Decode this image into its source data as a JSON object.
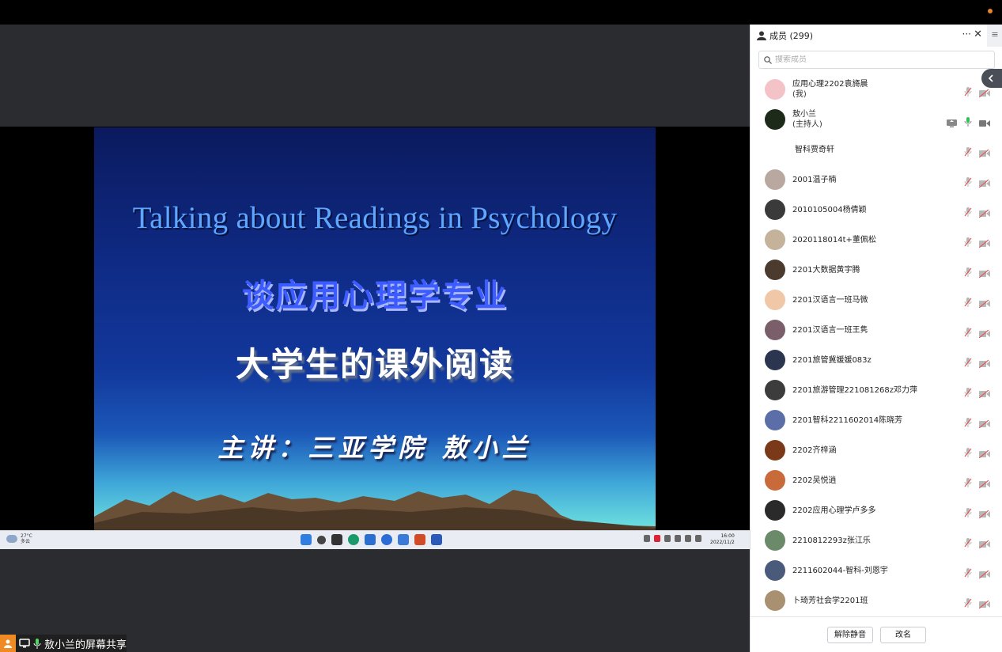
{
  "slide": {
    "title_en": "Talking about Readings in  Psychology",
    "title_cn": "谈应用心理学专业",
    "subtitle": "大学生的课外阅读",
    "speaker": "主讲：三亚学院 敖小兰"
  },
  "taskbar": {
    "weather_temp": "27°C",
    "weather_desc": "多云",
    "time": "16:00",
    "date": "2022/11/2"
  },
  "share_label": "敖小兰的屏幕共享",
  "panel": {
    "title": "成员 (299)",
    "more_label": "···",
    "close_label": "✕",
    "menu_label": "≡",
    "search_placeholder": "搜索成员",
    "members": [
      {
        "name": "应用心理2202袁旖晨",
        "sub": "(我)",
        "avatar": "#f3c3c8",
        "mic": "muted",
        "cam": "off"
      },
      {
        "name": "敖小兰",
        "sub": "(主持人)",
        "avatar": "#1d2a1a",
        "mic": "on",
        "cam": "on",
        "screen": true
      },
      {
        "name": "智科贾奇轩",
        "sub": "",
        "avatar": "none",
        "mic": "muted",
        "cam": "off"
      },
      {
        "name": "2001温子楠",
        "sub": "",
        "avatar": "#b9a8a0",
        "mic": "muted",
        "cam": "off"
      },
      {
        "name": "2010105004杨倩颖",
        "sub": "",
        "avatar": "#3a3a3a",
        "mic": "muted",
        "cam": "off"
      },
      {
        "name": "2020118014t+董佩松",
        "sub": "",
        "avatar": "#c4b39a",
        "mic": "muted",
        "cam": "off"
      },
      {
        "name": "2201大数据黄宇腾",
        "sub": "",
        "avatar": "#4b3a2e",
        "mic": "muted",
        "cam": "off"
      },
      {
        "name": "2201汉语言一班马微",
        "sub": "",
        "avatar": "#f0c8a8",
        "mic": "muted",
        "cam": "off"
      },
      {
        "name": "2201汉语言一班王隽",
        "sub": "",
        "avatar": "#7a5f6a",
        "mic": "muted",
        "cam": "off"
      },
      {
        "name": "2201旅管冀媛媛083z",
        "sub": "",
        "avatar": "#2c3550",
        "mic": "muted",
        "cam": "off"
      },
      {
        "name": "2201旅游管理221081268z邓力萍",
        "sub": "",
        "avatar": "#3c3c3c",
        "mic": "muted",
        "cam": "off"
      },
      {
        "name": "2201智科2211602014陈晓芳",
        "sub": "",
        "avatar": "#5b6ea8",
        "mic": "muted",
        "cam": "off"
      },
      {
        "name": "2202齐梓涵",
        "sub": "",
        "avatar": "#7a3a1a",
        "mic": "muted",
        "cam": "off"
      },
      {
        "name": "2202吴悦逍",
        "sub": "",
        "avatar": "#c86a3a",
        "mic": "muted",
        "cam": "off"
      },
      {
        "name": "2202应用心理学卢多多",
        "sub": "",
        "avatar": "#2a2a2a",
        "mic": "muted",
        "cam": "off"
      },
      {
        "name": "2210812293z张江乐",
        "sub": "",
        "avatar": "#6a8a6a",
        "mic": "muted",
        "cam": "off"
      },
      {
        "name": "2211602044-智科-刘恩宇",
        "sub": "",
        "avatar": "#4a5a7a",
        "mic": "muted",
        "cam": "off"
      },
      {
        "name": "卜琦芳社会学2201班",
        "sub": "",
        "avatar": "#a89070",
        "mic": "muted",
        "cam": "off"
      }
    ],
    "unmute_label": "解除静音",
    "rename_label": "改名"
  }
}
